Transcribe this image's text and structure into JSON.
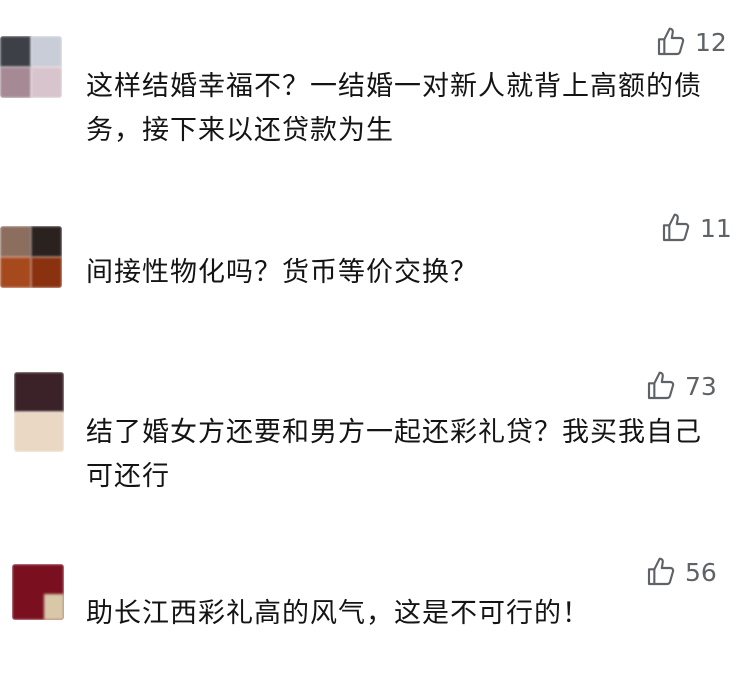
{
  "comments": [
    {
      "username": "",
      "likes": "12",
      "text": "这样结婚幸福不？一结婚一对新人就背上高额的债务，接下来以还贷款为生"
    },
    {
      "username": "",
      "likes": "11",
      "text": "间接性物化吗？货币等价交换？"
    },
    {
      "username": "",
      "likes": "73",
      "text": "结了婚女方还要和男方一起还彩礼贷？我买我自己可还行"
    },
    {
      "username": "",
      "likes": "56",
      "text": "助长江西彩礼高的风气，这是不可行的！"
    }
  ],
  "icons": {
    "like": "thumbs-up-icon"
  },
  "colors": {
    "text": "#141414",
    "meta": "#5f6368",
    "background": "#ffffff"
  }
}
